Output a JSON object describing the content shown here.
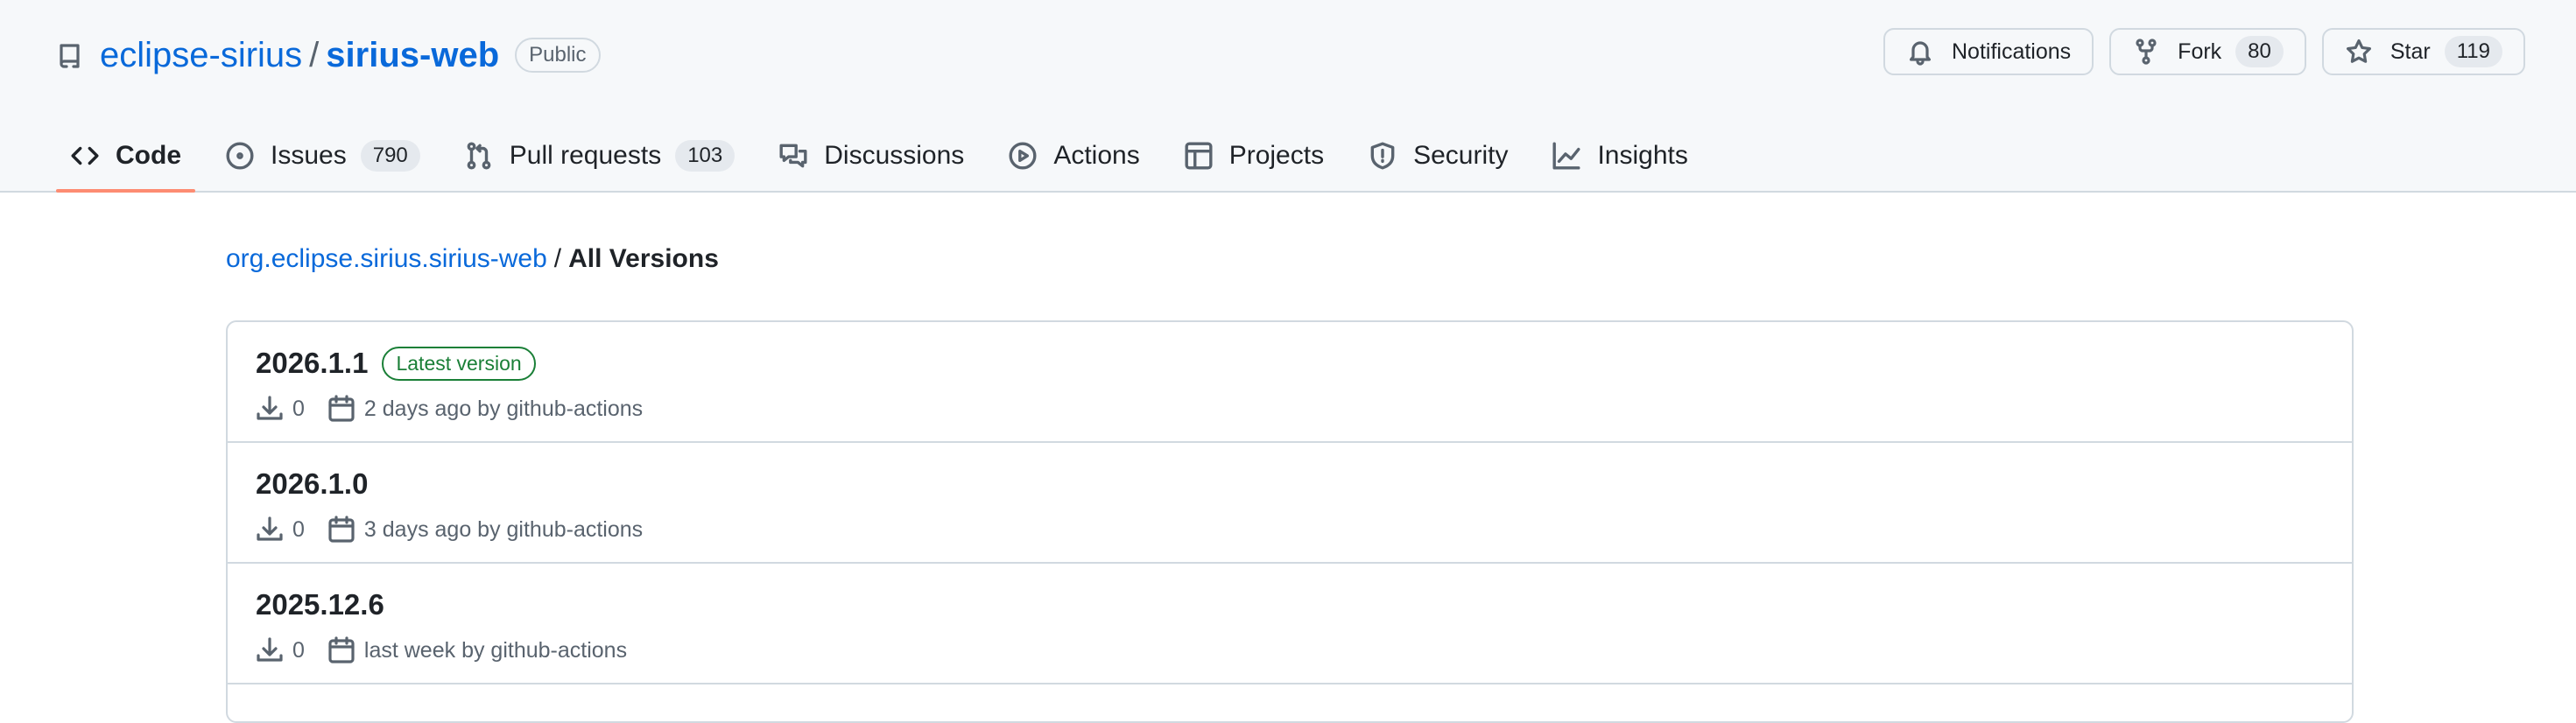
{
  "repo": {
    "owner": "eclipse-sirius",
    "separator": "/",
    "name": "sirius-web",
    "visibility": "Public"
  },
  "actions": {
    "notifications_label": "Notifications",
    "fork_label": "Fork",
    "fork_count": "80",
    "star_label": "Star",
    "star_count": "119"
  },
  "tabs": [
    {
      "label": "Code",
      "icon": "code-icon",
      "selected": true
    },
    {
      "label": "Issues",
      "icon": "issue-opened-icon",
      "counter": "790"
    },
    {
      "label": "Pull requests",
      "icon": "git-pull-request-icon",
      "counter": "103"
    },
    {
      "label": "Discussions",
      "icon": "comment-discussion-icon"
    },
    {
      "label": "Actions",
      "icon": "play-icon"
    },
    {
      "label": "Projects",
      "icon": "table-icon"
    },
    {
      "label": "Security",
      "icon": "shield-icon"
    },
    {
      "label": "Insights",
      "icon": "graph-icon"
    }
  ],
  "breadcrumb": {
    "package": "org.eclipse.sirius.sirius-web",
    "separator": "/",
    "current": "All Versions"
  },
  "versions": [
    {
      "version": "2026.1.1",
      "badge": "Latest version",
      "downloads": "0",
      "published": "2 days ago by github-actions"
    },
    {
      "version": "2026.1.0",
      "downloads": "0",
      "published": "3 days ago by github-actions"
    },
    {
      "version": "2025.12.6",
      "downloads": "0",
      "published": "last week by github-actions"
    }
  ],
  "colors": {
    "link": "#0969da",
    "selected_tab_underline": "#fd8c73",
    "latest_badge": "#1a7f37"
  }
}
